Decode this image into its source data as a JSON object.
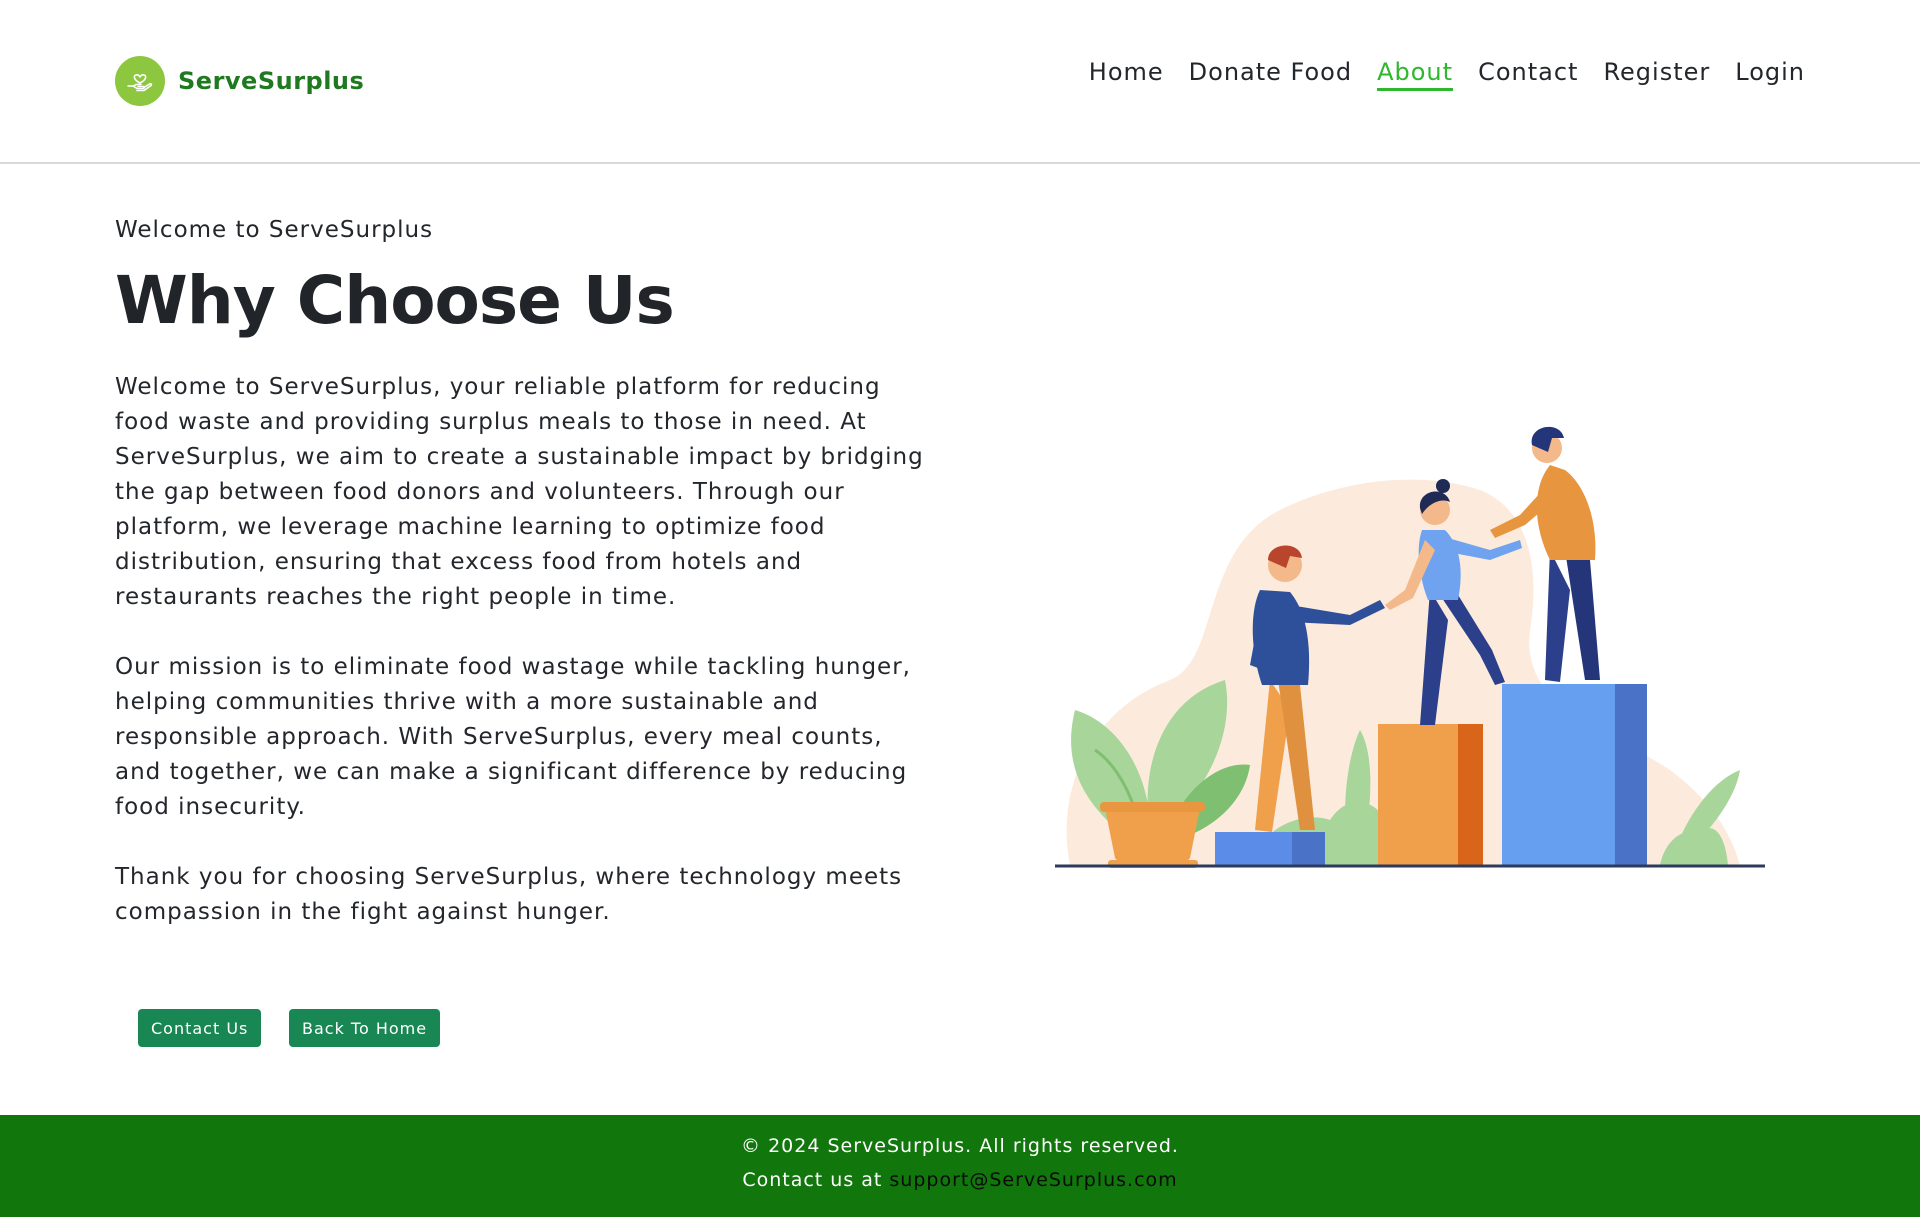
{
  "brand": {
    "name": "ServeSurplus",
    "logo_icon": "hand-heart-icon",
    "logo_color": "#8dc63f"
  },
  "nav": {
    "items": [
      {
        "label": "Home",
        "active": false
      },
      {
        "label": "Donate Food",
        "active": false
      },
      {
        "label": "About",
        "active": true
      },
      {
        "label": "Contact",
        "active": false
      },
      {
        "label": "Register",
        "active": false
      },
      {
        "label": "Login",
        "active": false
      }
    ],
    "active_color": "#2eb82e"
  },
  "main": {
    "eyebrow": "Welcome to ServeSurplus",
    "title": "Why Choose Us",
    "paragraphs": [
      "Welcome to ServeSurplus, your reliable platform for reducing food waste and providing surplus meals to those in need. At ServeSurplus, we aim to create a sustainable impact by bridging the gap between food donors and volunteers. Through our platform, we leverage machine learning to optimize food distribution, ensuring that excess food from hotels and restaurants reaches the right people in time.",
      "Our mission is to eliminate food wastage while tackling hunger, helping communities thrive with a more sustainable and responsible approach. With ServeSurplus, every meal counts, and together, we can make a significant difference by reducing food insecurity.",
      "Thank you for choosing ServeSurplus, where technology meets compassion in the fight against hunger."
    ],
    "buttons": {
      "contact": "Contact Us",
      "home": "Back To Home"
    },
    "button_color": "#198754",
    "illustration_icon": "teamwork-illustration"
  },
  "footer": {
    "copyright": "© 2024 ServeSurplus. All rights reserved.",
    "contact_prefix": "Contact us at ",
    "contact_email": "support@ServeSurplus.com",
    "background": "#11760c"
  }
}
